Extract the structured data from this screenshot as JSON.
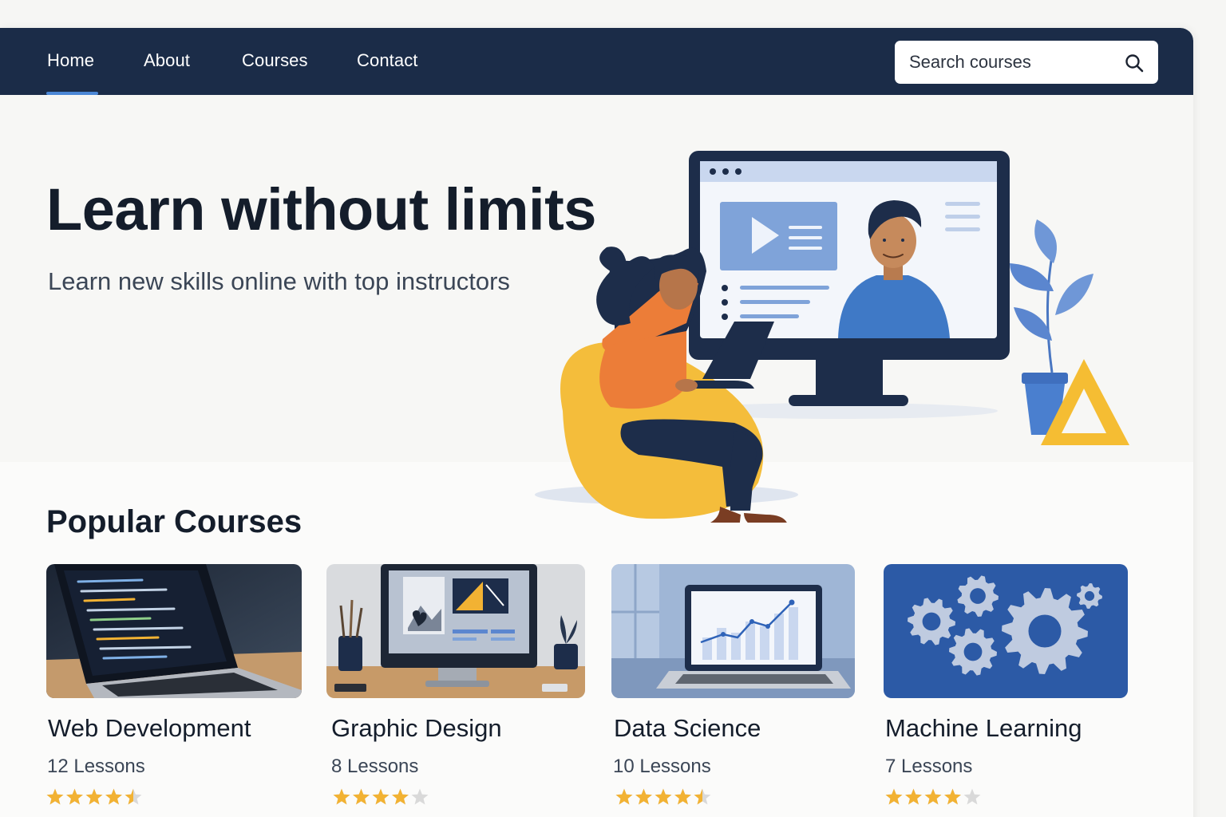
{
  "nav": {
    "links": [
      {
        "label": "Home",
        "active": true
      },
      {
        "label": "About",
        "active": false
      },
      {
        "label": "Courses",
        "active": false
      },
      {
        "label": "Contact",
        "active": false
      }
    ],
    "search": {
      "placeholder": "Search courses",
      "value": "",
      "icon": "search-icon"
    }
  },
  "hero": {
    "title": "Learn without limits",
    "subtitle": "Learn new skills online with top instructors",
    "illustration": "student-with-laptop-and-video-lesson-illustration"
  },
  "courses": {
    "heading": "Popular Courses",
    "items": [
      {
        "title": "Web Development",
        "lessons": "12 Lessons",
        "rating": 4.5,
        "thumbnail": "laptop-code-photo"
      },
      {
        "title": "Graphic Design",
        "lessons": "8 Lessons",
        "rating": 4,
        "thumbnail": "design-monitor-photo"
      },
      {
        "title": "Data Science",
        "lessons": "10 Lessons",
        "rating": 4.5,
        "thumbnail": "laptop-chart-photo"
      },
      {
        "title": "Machine Learning",
        "lessons": "7 Lessons",
        "rating": 4,
        "thumbnail": "gears-graphic"
      }
    ]
  },
  "colors": {
    "nav_bg": "#1b2c48",
    "accent": "#4b87d6",
    "star": "#f2b233",
    "star_empty": "#d9d9d9"
  }
}
